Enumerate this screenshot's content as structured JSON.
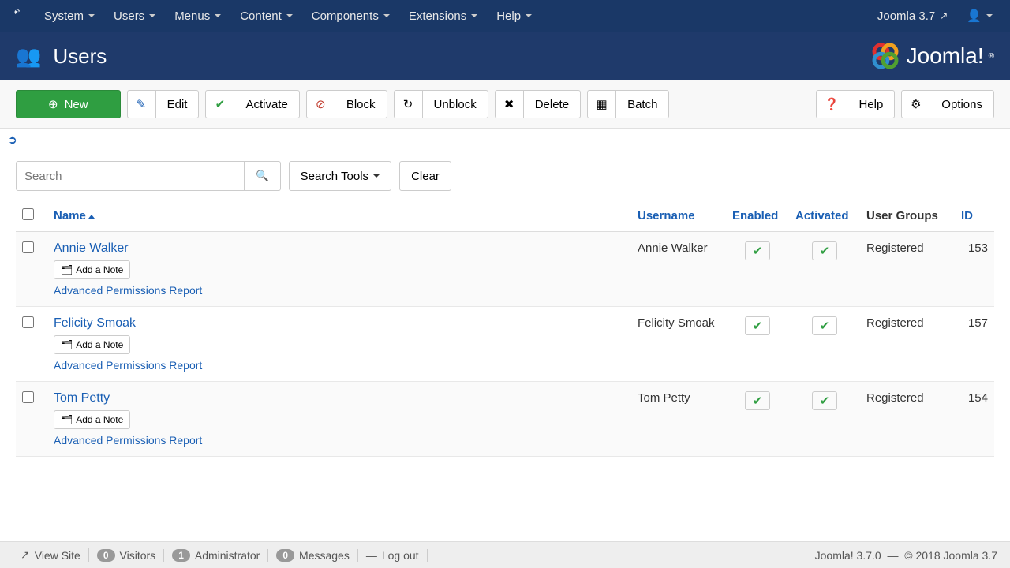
{
  "topbar": {
    "menus": [
      "System",
      "Users",
      "Menus",
      "Content",
      "Components",
      "Extensions",
      "Help"
    ],
    "version_link": "Joomla 3.7"
  },
  "header": {
    "title": "Users",
    "logo_text": "Joomla!",
    "logo_reg": "®"
  },
  "toolbar": {
    "new": "New",
    "edit": "Edit",
    "activate": "Activate",
    "block": "Block",
    "unblock": "Unblock",
    "delete": "Delete",
    "batch": "Batch",
    "help": "Help",
    "options": "Options"
  },
  "filters": {
    "search_placeholder": "Search",
    "search_tools": "Search Tools",
    "clear": "Clear"
  },
  "columns": {
    "name": "Name",
    "username": "Username",
    "enabled": "Enabled",
    "activated": "Activated",
    "groups": "User Groups",
    "id": "ID"
  },
  "rows": [
    {
      "name": "Annie Walker",
      "username": "Annie Walker",
      "group": "Registered",
      "id": "153"
    },
    {
      "name": "Felicity Smoak",
      "username": "Felicity Smoak",
      "group": "Registered",
      "id": "157"
    },
    {
      "name": "Tom Petty",
      "username": "Tom Petty",
      "group": "Registered",
      "id": "154"
    }
  ],
  "row_actions": {
    "add_note": "Add a Note",
    "perm_report": "Advanced Permissions Report"
  },
  "footer": {
    "view_site": "View Site",
    "visitors_count": "0",
    "visitors": "Visitors",
    "admin_count": "1",
    "admin": "Administrator",
    "messages_count": "0",
    "messages": "Messages",
    "logout": "Log out",
    "version": "Joomla! 3.7.0",
    "dash": "—",
    "copyright": "© 2018 Joomla 3.7"
  }
}
